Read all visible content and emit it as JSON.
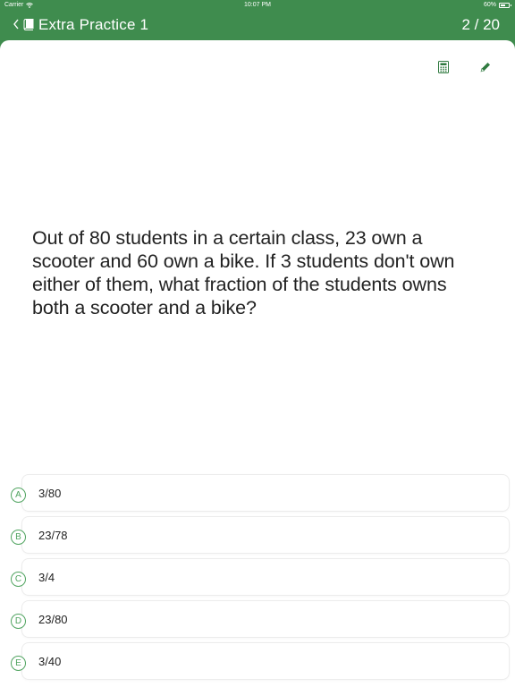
{
  "status_bar": {
    "carrier": "Carrier",
    "time": "10:07 PM",
    "battery": "60%"
  },
  "nav": {
    "back_icon": "chevron-left-icon",
    "book_icon": "book-icon",
    "title": "Extra Practice 1",
    "counter": "2 / 20"
  },
  "toolbar": {
    "calculator_icon": "calculator-icon",
    "pencil_icon": "pencil-icon"
  },
  "question": {
    "text": "Out of 80 students in a certain class, 23 own a scooter and 60 own a bike. If 3 students don't own either of them, what fraction of the students owns both a scooter and a bike?"
  },
  "choices": [
    {
      "letter": "A",
      "text": "3/80"
    },
    {
      "letter": "B",
      "text": "23/78"
    },
    {
      "letter": "C",
      "text": "3/4"
    },
    {
      "letter": "D",
      "text": "23/80"
    },
    {
      "letter": "E",
      "text": "3/40"
    }
  ],
  "colors": {
    "header": "#3f8c4e",
    "accent": "#4fa35f"
  }
}
